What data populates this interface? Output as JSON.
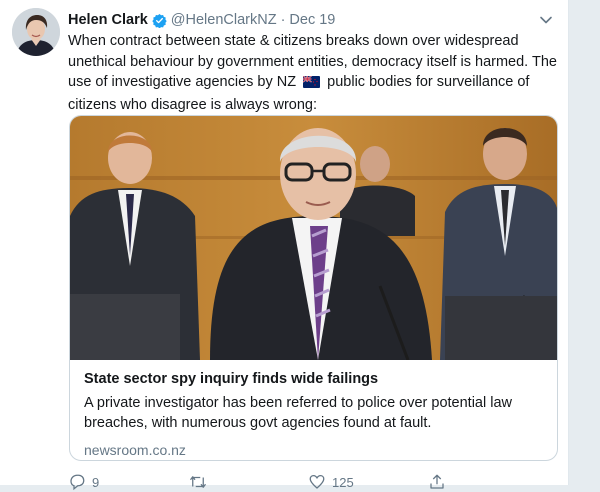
{
  "author": {
    "name": "Helen Clark",
    "handle": "@HelenClarkNZ",
    "separator": "·",
    "date": "Dec 19",
    "verified": true
  },
  "tweet": {
    "text_before_flag": "When contract between state & citizens breaks down over widespread unethical behaviour by government entities, democracy itself is harmed. The use of investigative agencies by NZ",
    "flag_icon": "new-zealand-flag-icon",
    "text_after_flag": "public bodies for surveillance of citizens who disagree is always wrong:"
  },
  "card": {
    "title": "State sector spy inquiry finds wide failings",
    "description": "A private investigator has been referred to police over potential law breaches, with numerous govt agencies found at fault.",
    "domain": "newsroom.co.nz"
  },
  "actions": {
    "reply_count": "9",
    "retweet_count": "",
    "like_count": "125",
    "icons": [
      "reply-icon",
      "retweet-icon",
      "like-icon",
      "share-icon"
    ]
  },
  "colors": {
    "text": "#14171a",
    "secondary": "#657786",
    "verified_blue": "#1da1f2",
    "border": "#ccd6dd"
  }
}
